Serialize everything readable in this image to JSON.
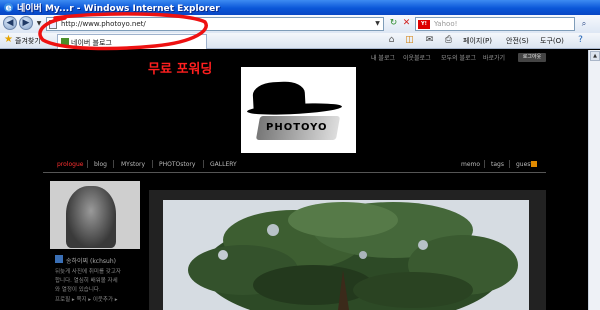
{
  "window": {
    "title": "네이버 My...r - Windows Internet Explorer"
  },
  "address_bar": {
    "url": "http://www.photoyo.net/"
  },
  "search": {
    "placeholder": "Yahoo!"
  },
  "favorites": {
    "label": "즐겨찾기",
    "tab_label": "네이버 블로그"
  },
  "command_bar": {
    "page": "페이지(P)",
    "safety": "안전(S)",
    "tools": "도구(O)"
  },
  "annotation": {
    "text": "무료 포워딩",
    "color": "#ff1f1f"
  },
  "blog_top_links": {
    "my_blog": "내 블로그",
    "neighbor_blog": "이웃블로그",
    "all_blogs": "모두의 블로그",
    "shortcut": "바로가기",
    "logout": "로그아웃"
  },
  "logo": {
    "text": "PHOTOYO"
  },
  "blog_nav": {
    "items": [
      "prologue",
      "blog",
      "MYstory",
      "PHOTOstory",
      "GALLERY"
    ],
    "right_items": [
      "memo",
      "tags",
      "guest"
    ]
  },
  "profile": {
    "name": "송하이찌 (kchsuh)",
    "description": [
      "뒤늦게 사진에 취미를 갖고자",
      "합니다. 열심히 배워볼 자세",
      "와 열정이 있습니다."
    ],
    "links": "프로필 ▸ 쪽지 ▸ 이웃추가 ▸"
  },
  "colors": {
    "accent_red": "#ff1f1f",
    "titlebar_blue": "#0a56d8",
    "page_bg": "#000000"
  }
}
